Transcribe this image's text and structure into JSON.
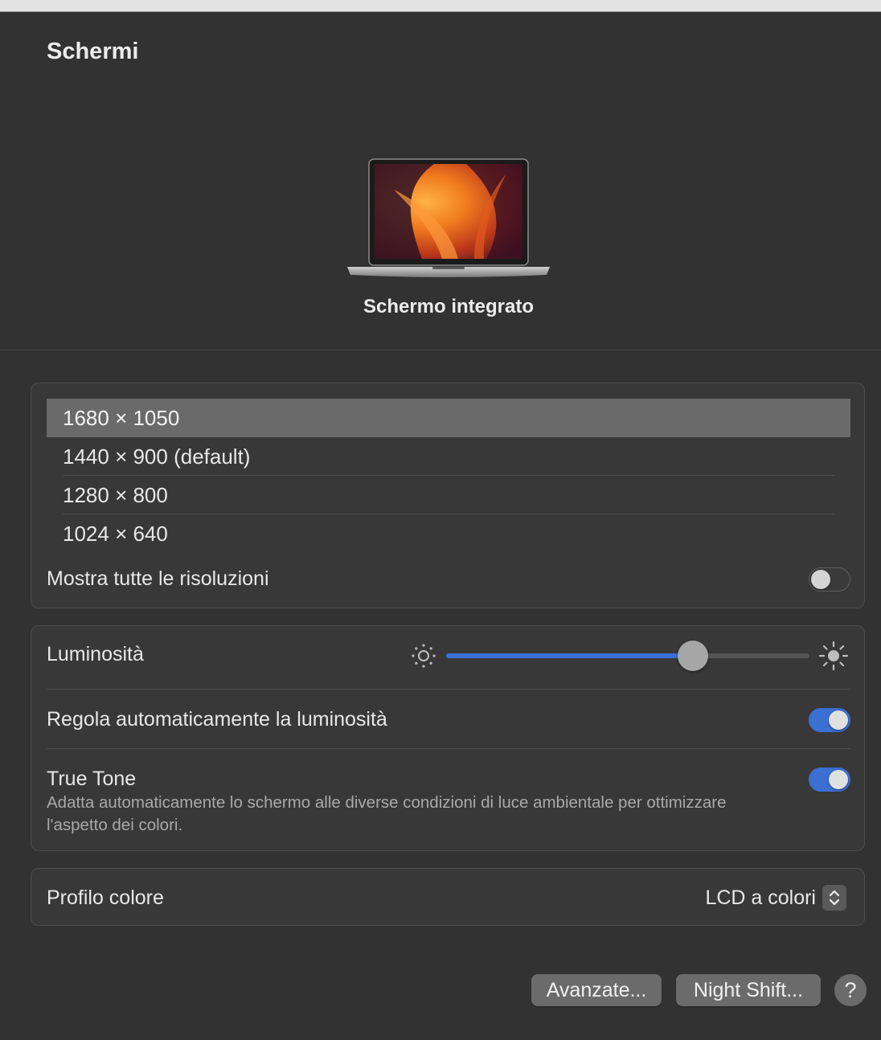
{
  "window": {
    "title": "Schermi"
  },
  "display": {
    "name": "Schermo integrato"
  },
  "resolutions": {
    "items": [
      {
        "label": "1680 × 1050",
        "selected": true
      },
      {
        "label": "1440 × 900 (default)",
        "selected": false
      },
      {
        "label": "1280 × 800",
        "selected": false
      },
      {
        "label": "1024 × 640",
        "selected": false
      }
    ],
    "show_all_label": "Mostra tutte le risoluzioni",
    "show_all_enabled": false
  },
  "brightness": {
    "label": "Luminosità",
    "level": 0.68,
    "auto_label": "Regola automaticamente la luminosità",
    "auto_enabled": true
  },
  "true_tone": {
    "label": "True Tone",
    "description": "Adatta automaticamente lo schermo alle diverse condizioni di luce ambientale per ottimizzare l'aspetto dei colori.",
    "enabled": true
  },
  "color_profile": {
    "label": "Profilo colore",
    "value": "LCD a colori"
  },
  "buttons": {
    "advanced": "Avanzate...",
    "night_shift": "Night Shift...",
    "help": "?"
  },
  "icons": {
    "laptop": "laptop-icon",
    "sun_small": "brightness-low-icon",
    "sun_large": "brightness-high-icon",
    "stepper": "up-down-chevron-icon"
  },
  "colors": {
    "accent": "#3b6fd2",
    "background": "#323232",
    "selection": "#6a6a6a"
  }
}
